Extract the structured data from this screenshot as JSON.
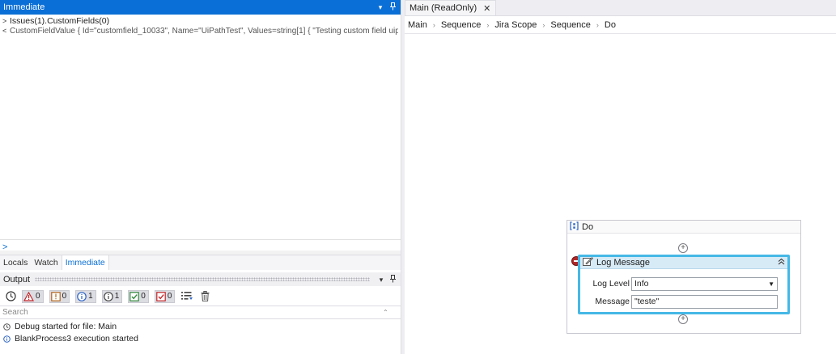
{
  "immediate": {
    "title": "Immediate",
    "lines": [
      {
        "prefix": ">",
        "text": "Issues(1).CustomFields(0)",
        "kind": "in"
      },
      {
        "prefix": "<",
        "text": "CustomFieldValue { Id=\"customfield_10033\", Name=\"UiPathTest\", Values=string[1] { \"Testing custom field uipath\" } }",
        "kind": "out"
      }
    ],
    "prompt": ">"
  },
  "debug_tabs": {
    "locals": "Locals",
    "watch": "Watch",
    "immediate": "Immediate"
  },
  "output": {
    "title": "Output",
    "filters": {
      "errors": "0",
      "warnings": "0",
      "info": "1",
      "trace": "1",
      "verbose": "0",
      "critical": "0"
    },
    "search_placeholder": "Search",
    "log": [
      {
        "text": "Debug started for file: Main",
        "icon": "clock-icon"
      },
      {
        "text": "BlankProcess3 execution started",
        "icon": "info-icon"
      }
    ]
  },
  "designer": {
    "tab": "Main (ReadOnly)",
    "breadcrumb": [
      "Main",
      "Sequence",
      "Jira Scope",
      "Sequence",
      "Do"
    ],
    "sequence_title": "Do",
    "activity": {
      "title": "Log Message",
      "level_label": "Log Level",
      "level_value": "Info",
      "message_label": "Message",
      "message_value": "\"teste\""
    }
  },
  "colors": {
    "accent": "#0a6fd6",
    "selection": "#45b8e6",
    "breakpoint": "#b1292a"
  }
}
